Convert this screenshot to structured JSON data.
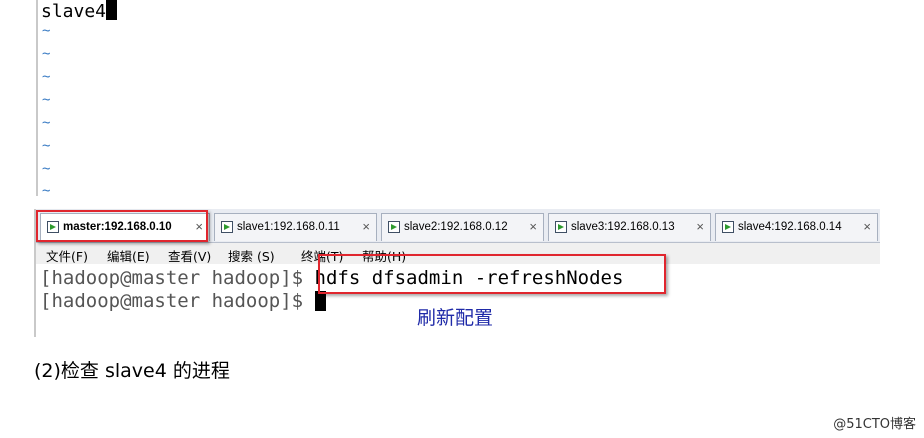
{
  "vim": {
    "text": "slave4",
    "tildes": [
      "~",
      "~",
      "~",
      "~",
      "~",
      "~",
      "~",
      "~"
    ]
  },
  "terminal": {
    "tabs": [
      {
        "label": "master:192.168.0.10",
        "close": "×"
      },
      {
        "label": "slave1:192.168.0.11",
        "close": "×"
      },
      {
        "label": "slave2:192.168.0.12",
        "close": "×"
      },
      {
        "label": "slave3:192.168.0.13",
        "close": "×"
      },
      {
        "label": "slave4:192.168.0.14",
        "close": "×"
      }
    ],
    "menu": [
      "文件(F)",
      "编辑(E)",
      "查看(V)",
      "搜索 (S)",
      "终端(T)",
      "帮助(H)"
    ],
    "lines": [
      {
        "prompt": "[hadoop@master hadoop]$ ",
        "command": "hdfs dfsadmin -refreshNodes"
      },
      {
        "prompt": "[hadoop@master hadoop]$ ",
        "command": ""
      }
    ]
  },
  "annotation": "刷新配置",
  "caption": "(2)检查 slave4 的进程",
  "watermark": "@51CTO博客",
  "colors": {
    "highlight": "#e0262e",
    "annotation": "#1f2aa8",
    "tilde": "#3a7cc4"
  }
}
